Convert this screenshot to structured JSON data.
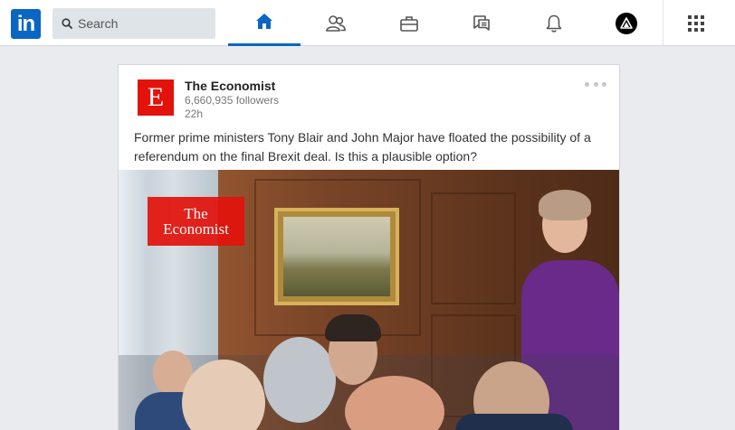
{
  "nav": {
    "logo_text": "in",
    "search_placeholder": "Search",
    "items": [
      {
        "name": "home",
        "icon": "home-icon",
        "active": true
      },
      {
        "name": "my-network",
        "icon": "people-icon",
        "active": false
      },
      {
        "name": "jobs",
        "icon": "briefcase-icon",
        "active": false
      },
      {
        "name": "messaging",
        "icon": "chat-icon",
        "active": false
      },
      {
        "name": "notifications",
        "icon": "bell-icon",
        "active": false
      },
      {
        "name": "me",
        "icon": "avatar-icon",
        "active": false
      },
      {
        "name": "work",
        "icon": "grid-icon",
        "active": false
      }
    ],
    "accent_color": "#0a66c2"
  },
  "post": {
    "author": "The Economist",
    "author_logo_letter": "E",
    "followers": "6,660,935 followers",
    "time": "22h",
    "text": "Former prime ministers Tony Blair and John Major have floated the possibility of a referendum on the final Brexit deal. Is this a plausible option?",
    "image": {
      "brand_line1": "The",
      "brand_line2": "Economist",
      "brand_color": "#e3120b"
    }
  }
}
